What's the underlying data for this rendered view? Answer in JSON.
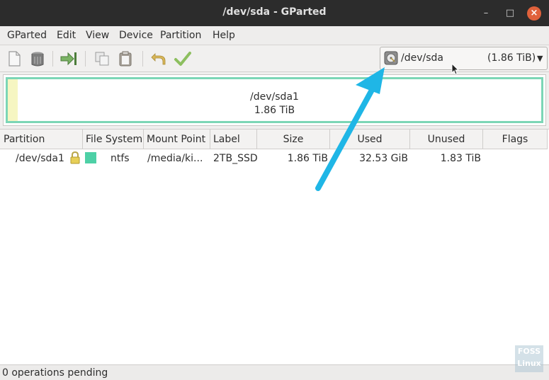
{
  "window": {
    "title": "/dev/sda - GParted"
  },
  "menu": [
    "GParted",
    "Edit",
    "View",
    "Device",
    "Partition",
    "Help"
  ],
  "toolbar": {
    "icons": [
      "new-icon",
      "delete-icon",
      "resize-move-icon",
      "copy-icon",
      "paste-icon",
      "undo-icon",
      "apply-icon"
    ]
  },
  "device_selector": {
    "name": "/dev/sda",
    "size": "(1.86 TiB)"
  },
  "disk_map": {
    "partition_name": "/dev/sda1",
    "partition_size": "1.86 TiB"
  },
  "table": {
    "headers": [
      "Partition",
      "File System",
      "Mount Point",
      "Label",
      "Size",
      "Used",
      "Unused",
      "Flags"
    ],
    "rows": [
      {
        "partition": "/dev/sda1",
        "filesystem": "ntfs",
        "mount_point": "/media/ki...",
        "label": "2TB_SSD",
        "size": "1.86 TiB",
        "used": "32.53 GiB",
        "unused": "1.83 TiB",
        "flags": ""
      }
    ]
  },
  "status": "0 operations pending",
  "watermark": {
    "line1": "FOSS",
    "line2": "Linux"
  },
  "colors": {
    "titlebar": "#2c2c2c",
    "close_button": "#e0613b",
    "ntfs": "#4dd0a6",
    "partition_border": "#7cd6b6",
    "annotation_arrow": "#1fb6e6"
  }
}
